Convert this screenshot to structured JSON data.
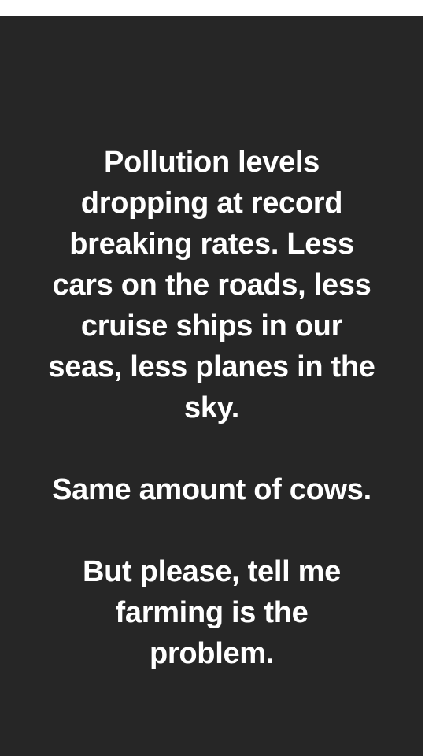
{
  "post": {
    "paragraphs": [
      {
        "lines": [
          "Pollution levels",
          "dropping at record",
          "breaking rates. Less",
          "cars on the roads, less",
          "cruise ships in our",
          "seas, less planes in the",
          "sky."
        ]
      },
      {
        "lines": [
          "Same amount of cows."
        ]
      },
      {
        "lines": [
          "But please, tell me",
          "farming is the",
          "problem."
        ]
      }
    ]
  },
  "colors": {
    "background": "#262626",
    "text": "#ffffff",
    "page": "#ffffff"
  }
}
